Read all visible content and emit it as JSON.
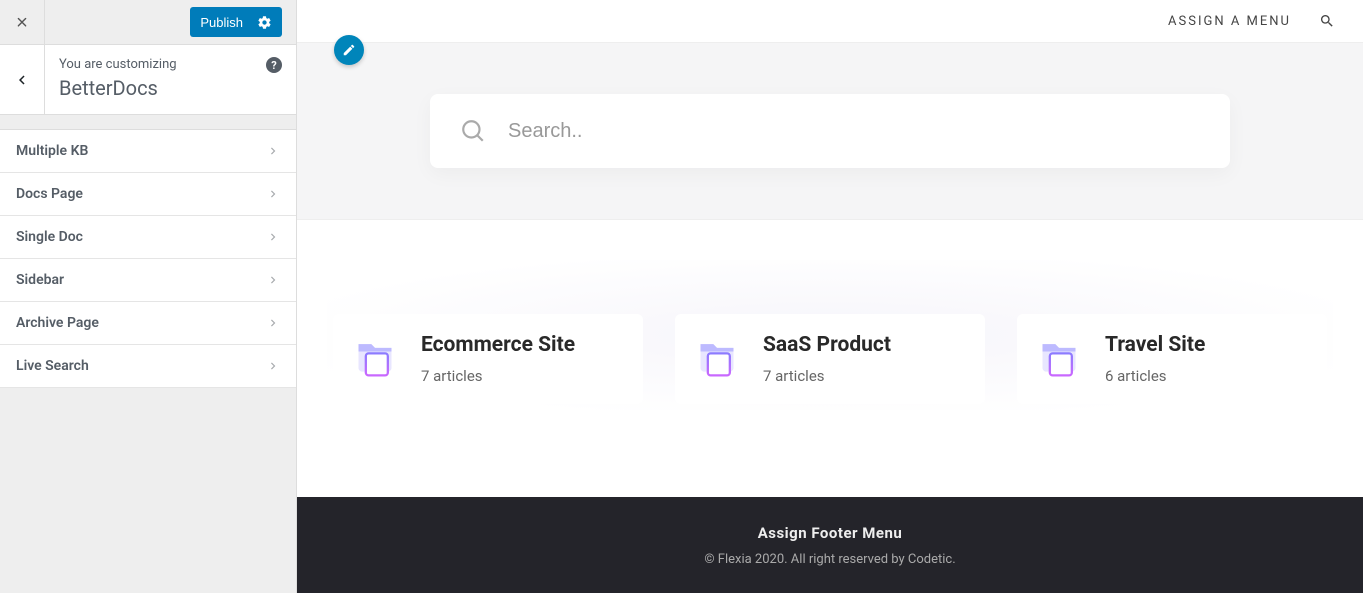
{
  "sidebar": {
    "publish_label": "Publish",
    "customizing_label": "You are customizing",
    "section_title": "BetterDocs",
    "menu": [
      {
        "label": "Multiple KB"
      },
      {
        "label": "Docs Page"
      },
      {
        "label": "Single Doc"
      },
      {
        "label": "Sidebar"
      },
      {
        "label": "Archive Page"
      },
      {
        "label": "Live Search"
      }
    ]
  },
  "preview": {
    "top_nav_text": "ASSIGN A MENU",
    "search_placeholder": "Search..",
    "cards": [
      {
        "title": "Ecommerce Site",
        "subtitle": "7 articles"
      },
      {
        "title": "SaaS Product",
        "subtitle": "7 articles"
      },
      {
        "title": "Travel Site",
        "subtitle": "6 articles"
      }
    ],
    "footer_menu": "Assign Footer Menu",
    "copyright": "© Flexia 2020. All right reserved by Codetic."
  }
}
